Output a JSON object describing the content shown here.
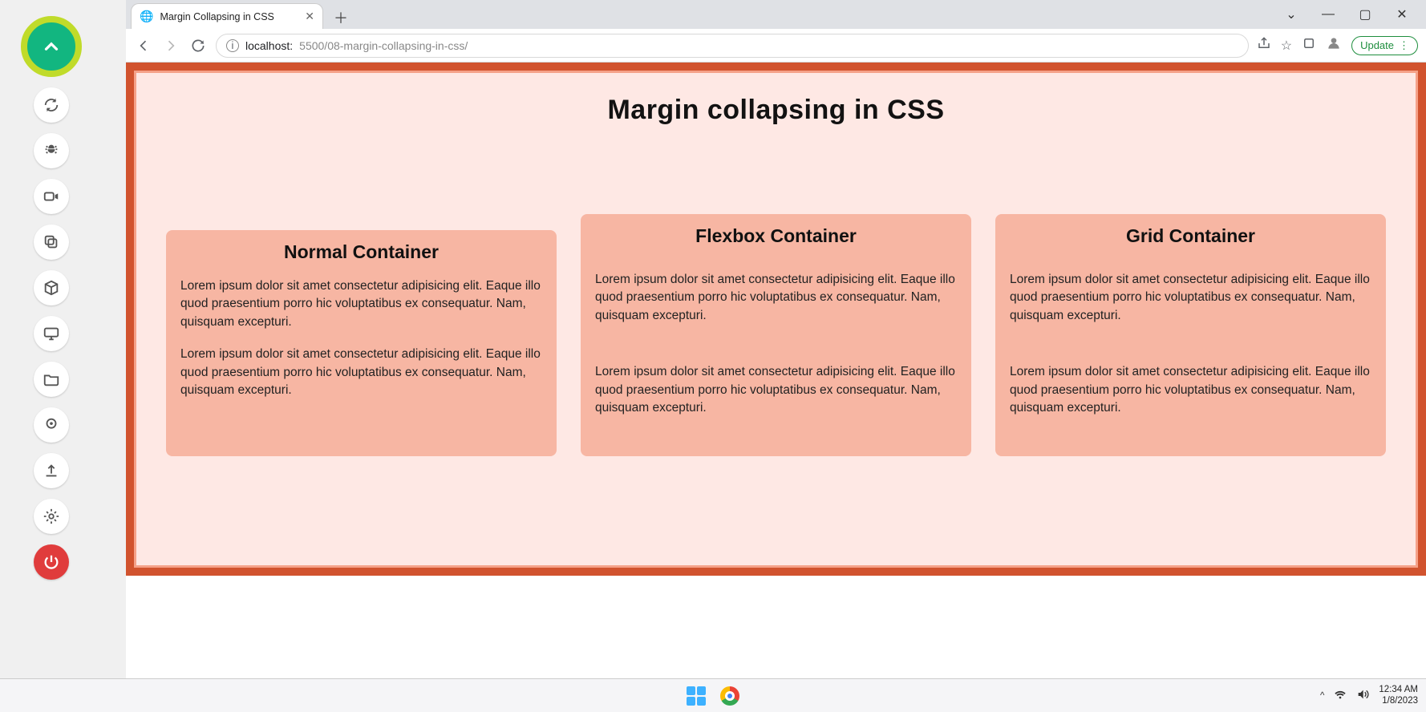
{
  "toolbar": {
    "icons": [
      "chevron-up",
      "refresh-loop",
      "bug",
      "video",
      "copy",
      "cube",
      "monitor",
      "folder",
      "pin",
      "upload",
      "gear",
      "power"
    ]
  },
  "browser": {
    "tab_title": "Margin Collapsing in CSS",
    "window_controls": {
      "dropdown": "⌄",
      "minimize": "—",
      "maximize": "▢",
      "close": "✕"
    },
    "url_host": "localhost:",
    "url_path": "5500/08-margin-collapsing-in-css/",
    "update_label": "Update"
  },
  "page": {
    "title": "Margin collapsing in CSS",
    "lorem": "Lorem ipsum dolor sit amet consectetur adipisicing elit. Eaque illo quod praesentium porro hic voluptatibus ex consequatur. Nam, quisquam excepturi.",
    "cards": {
      "normal": {
        "heading": "Normal Container"
      },
      "flexbox": {
        "heading": "Flexbox Container"
      },
      "grid": {
        "heading": "Grid Container"
      }
    }
  },
  "taskbar": {
    "time": "12:34 AM",
    "date": "1/8/2023",
    "tray_caret": "^"
  }
}
